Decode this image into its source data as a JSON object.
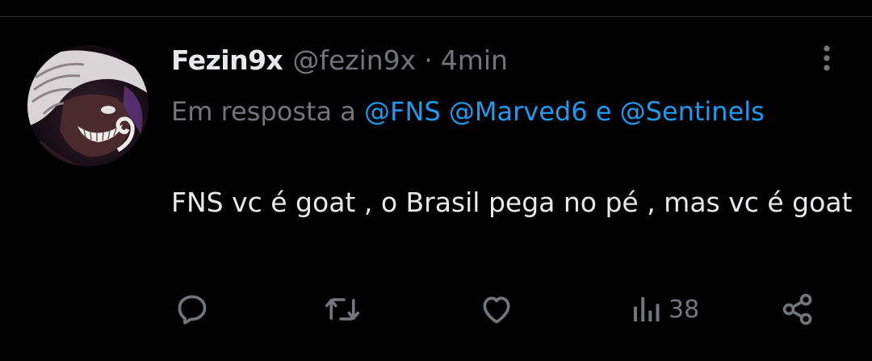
{
  "tweet": {
    "display_name": "Fezin9x",
    "handle": "@fezin9x",
    "separator": "·",
    "time": "4min",
    "reply_prefix": "Em resposta a",
    "mentions": [
      "@FNS",
      "@Marved6",
      "@Sentinels"
    ],
    "mention_conjunction": "e",
    "text": "FNS vc é goat , o Brasil pega no pé , mas vc é goat"
  },
  "actions": {
    "reply_icon": "reply-icon",
    "retweet_icon": "retweet-icon",
    "like_icon": "like-icon",
    "views_icon": "views-icon",
    "views_count": "38",
    "share_icon": "share-icon"
  },
  "colors": {
    "background": "#000000",
    "text_primary": "#e7e9ea",
    "text_secondary": "#71767b",
    "link": "#1d9bf0",
    "divider": "#2f3336"
  }
}
